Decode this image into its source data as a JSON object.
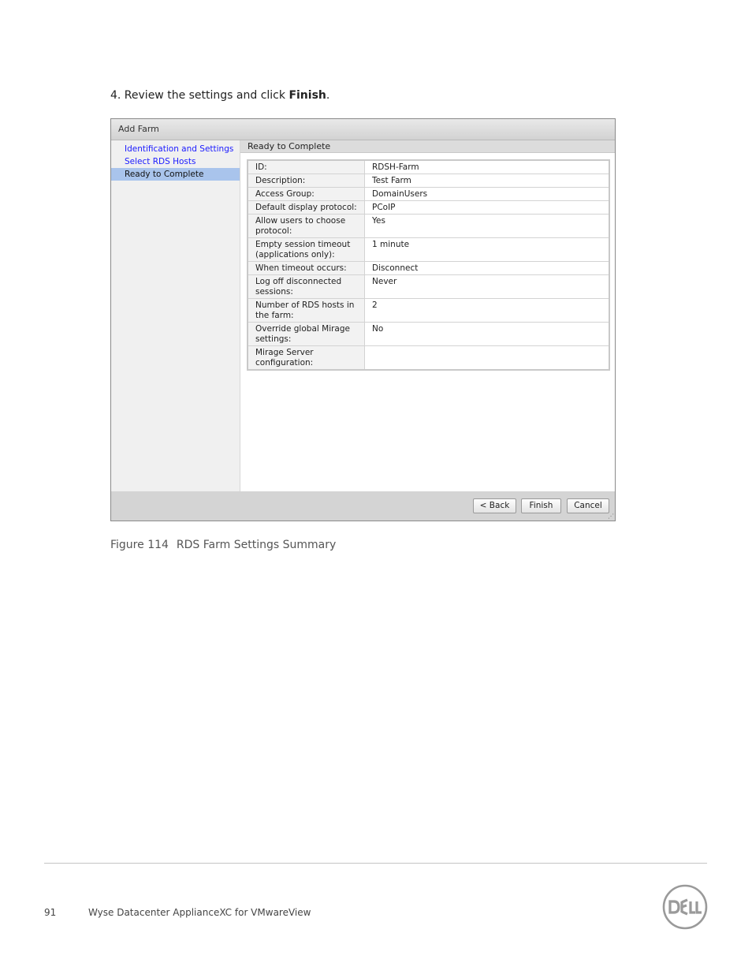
{
  "step": {
    "prefix": "4. Review  the settings  and click ",
    "bold": "Finish",
    "suffix": "."
  },
  "dialog": {
    "title": "Add Farm",
    "nav": [
      {
        "label": "Identification and Settings"
      },
      {
        "label": "Select RDS Hosts"
      },
      {
        "label": "Ready to Complete"
      }
    ],
    "section_title": "Ready to Complete",
    "rows": [
      {
        "label": "ID:",
        "value": "RDSH-Farm"
      },
      {
        "label": "Description:",
        "value": "Test Farm"
      },
      {
        "label": "Access Group:",
        "value": "DomainUsers"
      },
      {
        "label": "Default display protocol:",
        "value": "PCoIP"
      },
      {
        "label": "Allow users to choose protocol:",
        "value": "Yes"
      },
      {
        "label": "Empty session timeout (applications only):",
        "value": "1 minute"
      },
      {
        "label": "When timeout occurs:",
        "value": "Disconnect"
      },
      {
        "label": "Log off disconnected sessions:",
        "value": "Never"
      },
      {
        "label": "Number of RDS hosts in the farm:",
        "value": "2"
      },
      {
        "label": "Override global Mirage settings:",
        "value": "No"
      },
      {
        "label": "Mirage Server configuration:",
        "value": ""
      }
    ],
    "buttons": {
      "back": "< Back",
      "finish": "Finish",
      "cancel": "Cancel"
    }
  },
  "caption": {
    "figure": "Figure 114",
    "text": "RDS Farm Settings  Summary"
  },
  "footer": {
    "page_number": "91",
    "doc_title": "Wyse Datacenter ApplianceXC for VMwareView",
    "logo_text": "DELL"
  },
  "colors": {
    "link": "#1a1aff",
    "selected": "#a9c4ec",
    "logo": "#9a9a9a"
  }
}
